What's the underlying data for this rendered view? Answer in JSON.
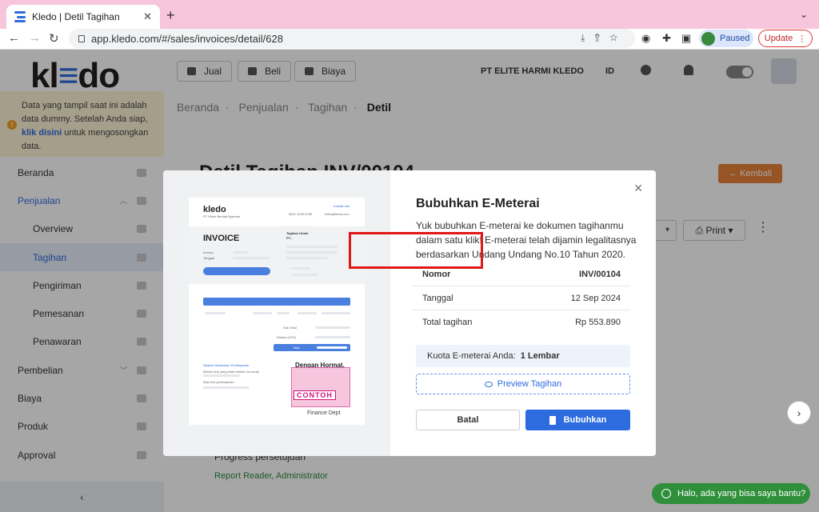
{
  "browser": {
    "tab_title": "Kledo | Detil Tagihan",
    "url": "app.kledo.com/#/sales/invoices/detail/628",
    "profile_label": "Paused",
    "update_label": "Update"
  },
  "sidebar": {
    "logo": "kledo",
    "notice_pre": "Data yang tampil saat ini adalah data dummy. Setelah Anda siap,",
    "notice_link": "klik disini",
    "notice_post": "untuk mengosongkan data.",
    "items": [
      {
        "label": "Beranda"
      },
      {
        "label": "Penjualan"
      },
      {
        "label": "Overview"
      },
      {
        "label": "Tagihan"
      },
      {
        "label": "Pengiriman"
      },
      {
        "label": "Pemesanan"
      },
      {
        "label": "Penawaran"
      },
      {
        "label": "Pembelian"
      },
      {
        "label": "Biaya"
      },
      {
        "label": "Produk"
      },
      {
        "label": "Approval"
      }
    ]
  },
  "topnav": {
    "jual": "Jual",
    "beli": "Beli",
    "biaya": "Biaya",
    "company": "PT ELITE HARMI KLEDO",
    "lang": "ID"
  },
  "breadcrumb": {
    "items": [
      "Beranda",
      "Penjualan",
      "Tagihan"
    ],
    "current": "Detil"
  },
  "page": {
    "title": "Detil Tagihan INV/00104",
    "back_label": "Kembali",
    "print_label": "Print",
    "progress_label": "Progress persetujuan",
    "approvers": "Report Reader, Administrator",
    "chat_label": "Halo, ada yang bisa saya bantu?"
  },
  "modal": {
    "title": "Bubuhkan E-Meterai",
    "description": "Yuk bubuhkan E-meterai ke dokumen tagihanmu dalam satu klik! E-meterai telah dijamin legalitasnya berdasarkan Undang Undang No.10 Tahun 2020.",
    "rows": [
      {
        "label": "Nomor",
        "value": "INV/00104"
      },
      {
        "label": "Tanggal",
        "value": "12 Sep 2024"
      },
      {
        "label": "Total tagihan",
        "value": "Rp 553.890"
      }
    ],
    "quota_label": "Kuota E-meterai Anda:",
    "quota_value": "1 Lembar",
    "preview_label": "Preview Tagihan",
    "cancel_label": "Batal",
    "submit_label": "Bubuhkan",
    "illustration": {
      "logo": "kledo",
      "company": "PT Kledo Berhati Nyaman",
      "contact": "Kontak Info",
      "phone": "0822 1234 5789",
      "email": "hello@kledo.com",
      "invoice_word": "INVOICE",
      "bill_to": "Tagihan Untuk",
      "bill_to_name": "PT...",
      "invoice_label": "Invoice",
      "date_label": "Tanggal",
      "subtotal": "Sub Total",
      "discount": "Diskon (10%)",
      "total": "Total",
      "payment_title": "Silakan Melakukan Pembayaran",
      "payment_line1": "Melalui link yang telah terkirim ke email",
      "payment_line2": "Atau link pembayaran",
      "closing": "Dengan Hormat,",
      "stamp_text": "CONTOH",
      "signatory": "Finance Dept"
    }
  }
}
